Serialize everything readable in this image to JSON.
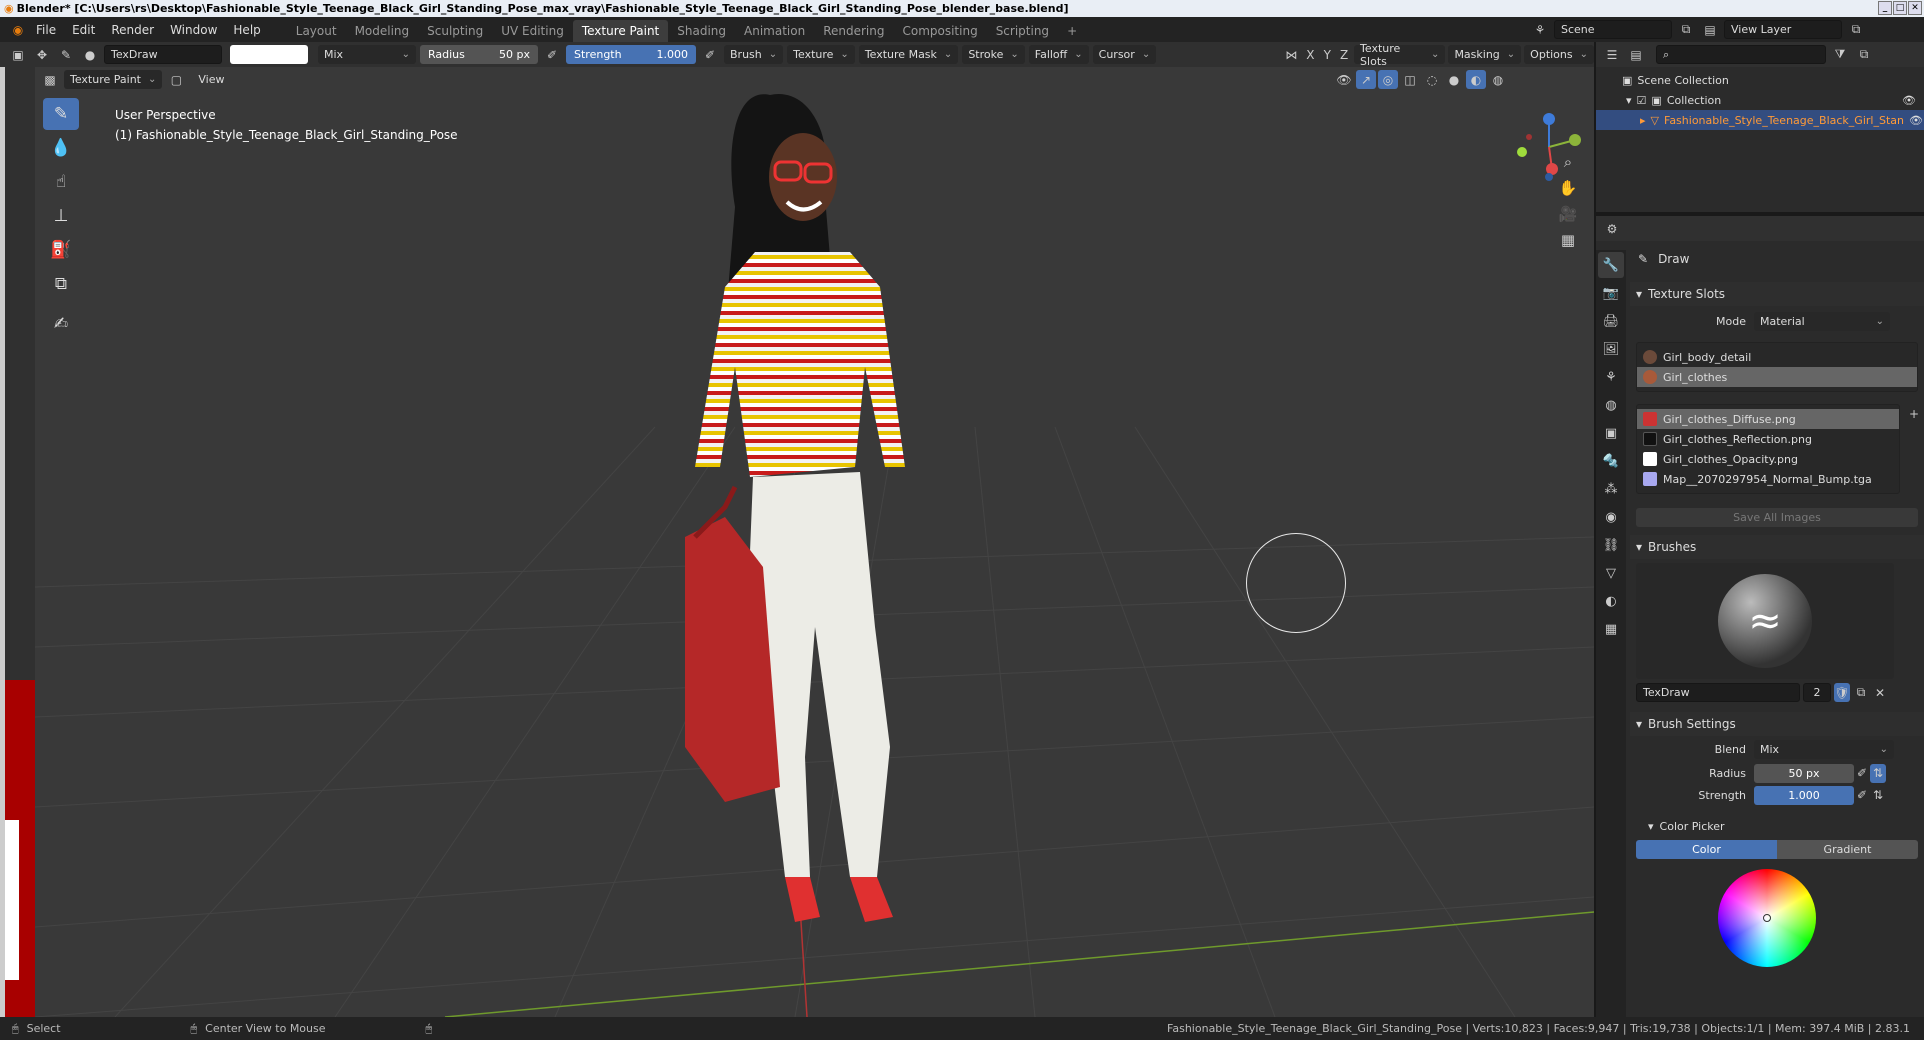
{
  "window": {
    "title": "Blender* [C:\\Users\\rs\\Desktop\\Fashionable_Style_Teenage_Black_Girl_Standing_Pose_max_vray\\Fashionable_Style_Teenage_Black_Girl_Standing_Pose_blender_base.blend]"
  },
  "menu": [
    "File",
    "Edit",
    "Render",
    "Window",
    "Help"
  ],
  "workspaces": [
    "Layout",
    "Modeling",
    "Sculpting",
    "UV Editing",
    "Texture Paint",
    "Shading",
    "Animation",
    "Rendering",
    "Compositing",
    "Scripting"
  ],
  "active_workspace": "Texture Paint",
  "scene": {
    "label": "Scene",
    "view_layer": "View Layer"
  },
  "tool_header": {
    "brush_name": "TexDraw",
    "blend": "Mix",
    "radius_label": "Radius",
    "radius_value": "50 px",
    "strength_label": "Strength",
    "strength_value": "1.000",
    "menus": [
      "Brush",
      "Texture",
      "Texture Mask",
      "Stroke",
      "Falloff",
      "Cursor"
    ],
    "axes": [
      "X",
      "Y",
      "Z"
    ],
    "right_menus": [
      "Texture Slots",
      "Masking",
      "Options"
    ]
  },
  "viewport_header": {
    "mode": "Texture Paint",
    "view": "View"
  },
  "viewport": {
    "perspective": "User Perspective",
    "object": "(1) Fashionable_Style_Teenage_Black_Girl_Standing_Pose"
  },
  "outliner": {
    "root": "Scene Collection",
    "collection": "Collection",
    "object": "Fashionable_Style_Teenage_Black_Girl_Stan"
  },
  "properties": {
    "tool_name": "Draw",
    "texture_slots": {
      "header": "Texture Slots",
      "mode_label": "Mode",
      "mode_value": "Material",
      "materials": [
        "Girl_body_detail",
        "Girl_clothes"
      ],
      "images": [
        "Girl_clothes_Diffuse.png",
        "Girl_clothes_Reflection.png",
        "Girl_clothes_Opacity.png",
        "Map__2070297954_Normal_Bump.tga"
      ],
      "save_all": "Save All Images"
    },
    "brushes": {
      "header": "Brushes",
      "name": "TexDraw",
      "users": "2"
    },
    "brush_settings": {
      "header": "Brush Settings",
      "blend_label": "Blend",
      "blend_value": "Mix",
      "radius_label": "Radius",
      "radius_value": "50 px",
      "strength_label": "Strength",
      "strength_value": "1.000",
      "color_picker": "Color Picker",
      "color_tab": "Color",
      "gradient_tab": "Gradient"
    }
  },
  "statusbar": {
    "select": "Select",
    "center": "Center View to Mouse",
    "stats": "Fashionable_Style_Teenage_Black_Girl_Standing_Pose | Verts:10,823 | Faces:9,947 | Tris:19,738 | Objects:1/1 | Mem: 397.4 MiB | 2.83.1"
  },
  "colors": {
    "accent": "#4772b3",
    "selected_object": "#ff9a37",
    "bag": "#b52828"
  }
}
